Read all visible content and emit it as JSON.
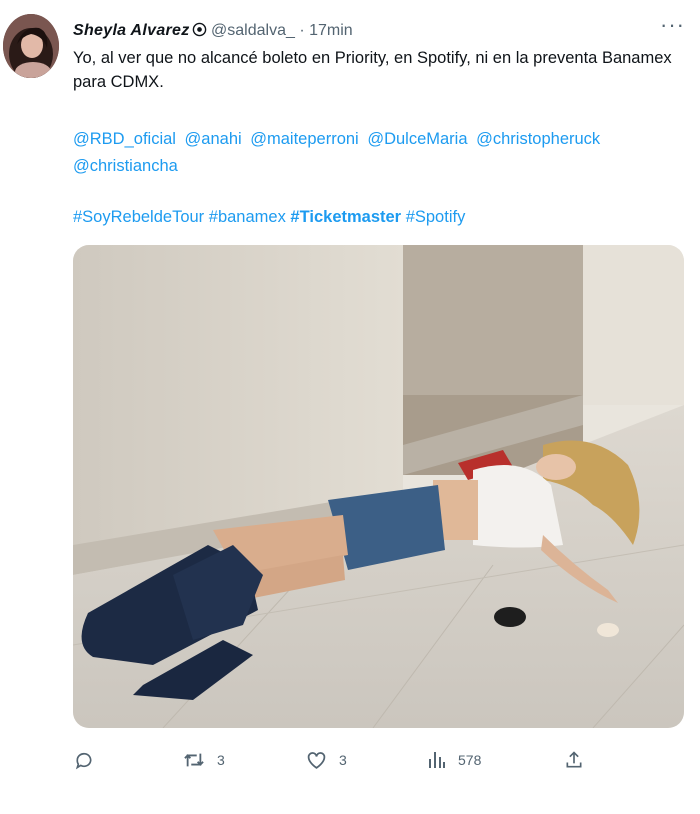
{
  "tweet": {
    "author_name": "Sheyla Alvarez",
    "handle": "@saldalva_",
    "separator": "·",
    "time": "17min",
    "more_label": "···",
    "text": "Yo, al ver que no alcancé boleto en Priority, en Spotify, ni en la preventa Banamex para CDMX.",
    "mentions": [
      "@RBD_oficial",
      "@anahi",
      "@maiteperroni",
      "@DulceMaria",
      "@christopheruck",
      "@christiancha"
    ],
    "hashtags": [
      "#SoyRebeldeTour",
      "#banamex",
      "#Ticketmaster",
      "#Spotify"
    ]
  },
  "actions": {
    "replies": "",
    "retweets": "3",
    "likes": "3",
    "views": "578"
  },
  "colors": {
    "link": "#1d9bf0",
    "secondary_text": "#536471",
    "primary_text": "#0f1419"
  }
}
